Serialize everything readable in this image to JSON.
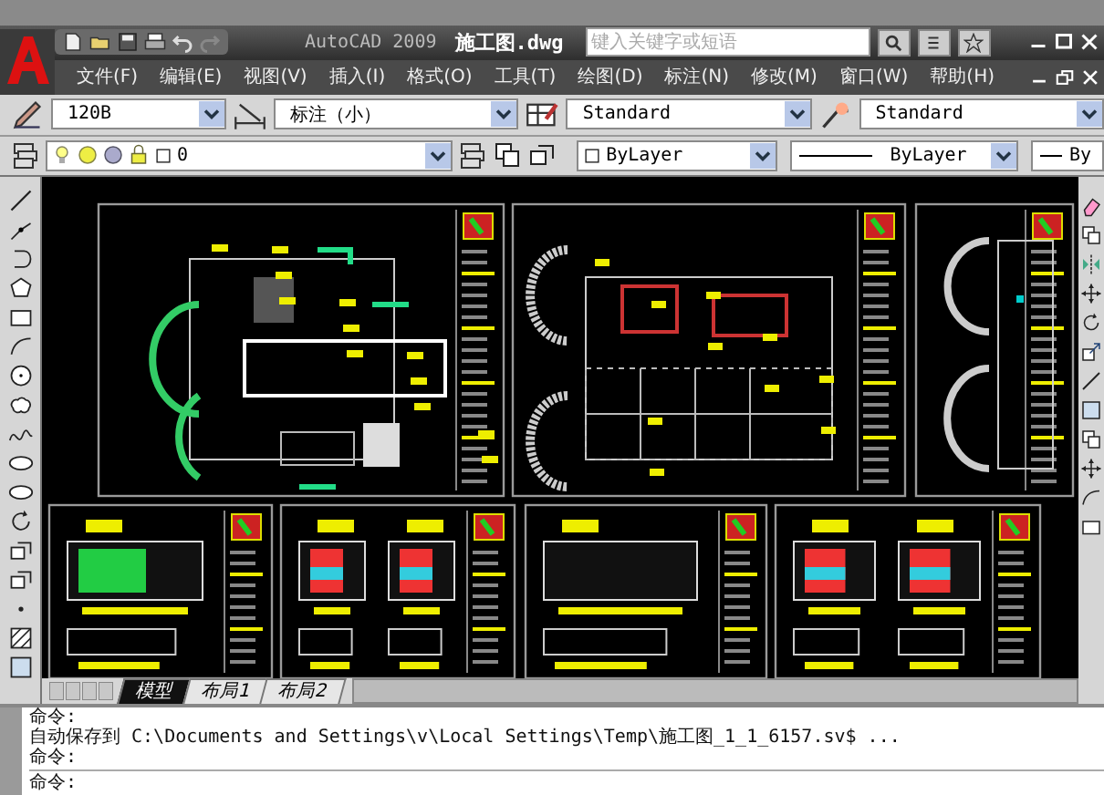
{
  "window": {
    "title": "AutoCAD 2009",
    "filename": "施工图.dwg"
  },
  "search": {
    "placeholder": "键入关键字或短语"
  },
  "menu": [
    {
      "label": "文件(F)"
    },
    {
      "label": "编辑(E)"
    },
    {
      "label": "视图(V)"
    },
    {
      "label": "插入(I)"
    },
    {
      "label": "格式(O)"
    },
    {
      "label": "工具(T)"
    },
    {
      "label": "绘图(D)"
    },
    {
      "label": "标注(N)"
    },
    {
      "label": "修改(M)"
    },
    {
      "label": "窗口(W)"
    },
    {
      "label": "帮助(H)"
    }
  ],
  "styles_toolbar": [
    {
      "kind": "text-style",
      "value": "120B"
    },
    {
      "kind": "dim-style",
      "value": "标注（小）"
    },
    {
      "kind": "table-style",
      "value": "Standard"
    },
    {
      "kind": "multileader-style",
      "value": "Standard"
    }
  ],
  "layers_toolbar": {
    "layer": "0",
    "color_setting": "ByLayer",
    "linetype": "ByLayer",
    "lineweight": "By"
  },
  "layout_tabs": [
    {
      "label": "模型",
      "selected": true
    },
    {
      "label": "布局1",
      "selected": false
    },
    {
      "label": "布局2",
      "selected": false
    }
  ],
  "command_history": [
    "命令:",
    "自动保存到 C:\\Documents and Settings\\v\\Local Settings\\Temp\\施工图_1_1_6157.sv$ ...",
    "命令:"
  ],
  "command_prompt": "命令:"
}
